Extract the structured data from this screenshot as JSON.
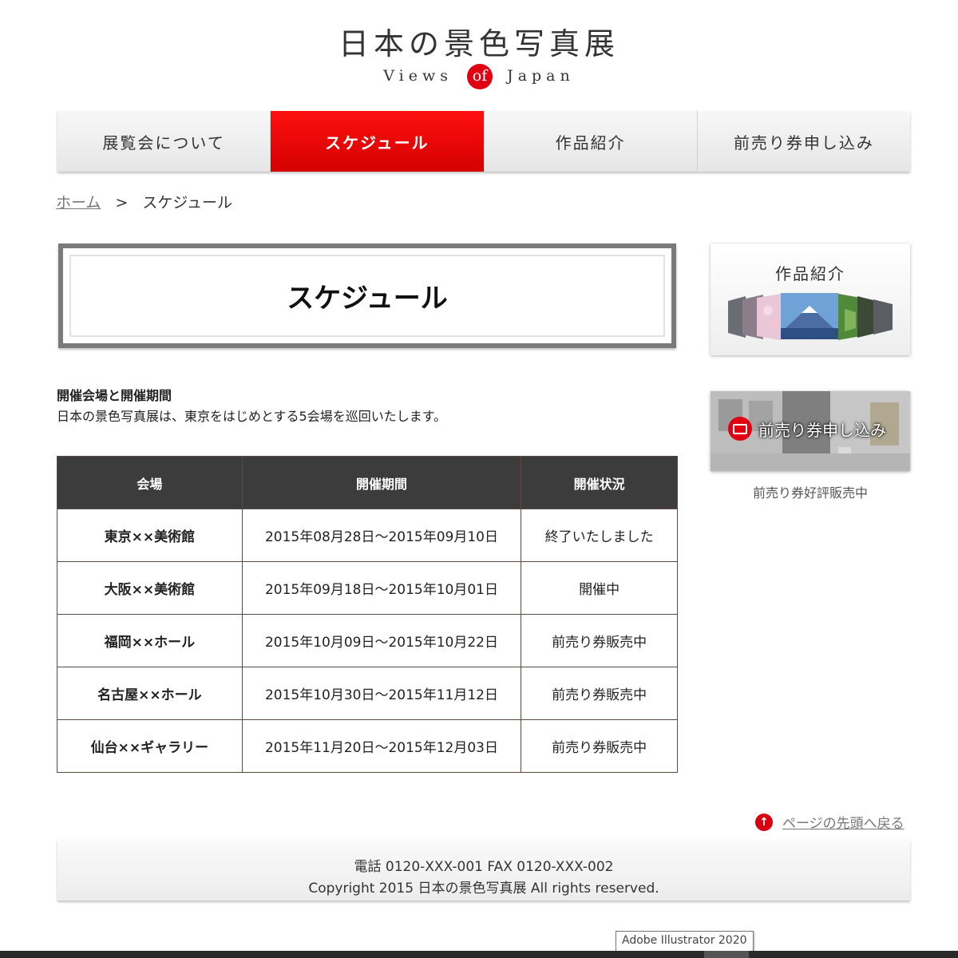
{
  "header": {
    "title": "日本の景色写真展",
    "subtitle_left": "Views",
    "subtitle_of": "of",
    "subtitle_right": "Japan",
    "accent_color": "#e00012"
  },
  "nav": {
    "items": [
      {
        "label": "展覧会について",
        "active": false
      },
      {
        "label": "スケジュール",
        "active": true
      },
      {
        "label": "作品紹介",
        "active": false
      },
      {
        "label": "前売り券申し込み",
        "active": false
      }
    ]
  },
  "breadcrumb": {
    "home": "ホーム",
    "separator": ">",
    "current": "スケジュール"
  },
  "main": {
    "page_title": "スケジュール",
    "intro_heading": "開催会場と開催期間",
    "intro_text": "日本の景色写真展は、東京をはじめとする5会場を巡回いたします。",
    "table": {
      "headers": [
        "会場",
        "開催期間",
        "開催状況"
      ],
      "rows": [
        {
          "venue": "東京××美術館",
          "period": "2015年08月28日～2015年09月10日",
          "status": "終了いたしました"
        },
        {
          "venue": "大阪××美術館",
          "period": "2015年09月18日～2015年10月01日",
          "status": "開催中"
        },
        {
          "venue": "福岡××ホール",
          "period": "2015年10月09日～2015年10月22日",
          "status": "前売り券販売中"
        },
        {
          "venue": "名古屋××ホール",
          "period": "2015年10月30日～2015年11月12日",
          "status": "前売り券販売中"
        },
        {
          "venue": "仙台××ギャラリー",
          "period": "2015年11月20日～2015年12月03日",
          "status": "前売り券販売中"
        }
      ]
    }
  },
  "sidebar": {
    "works_label": "作品紹介",
    "ticket_label": "前売り券申し込み",
    "ticket_note": "前売り券好評販売中"
  },
  "pagetop": {
    "label": "ページの先頭へ戻る",
    "icon": "arrow-up-icon"
  },
  "footer": {
    "contact": "電話 0120-XXX-001 FAX 0120-XXX-002",
    "copyright": "Copyright 2015 日本の景色写真展 All rights reserved."
  },
  "tooltip": {
    "text": "Adobe Illustrator 2020"
  }
}
